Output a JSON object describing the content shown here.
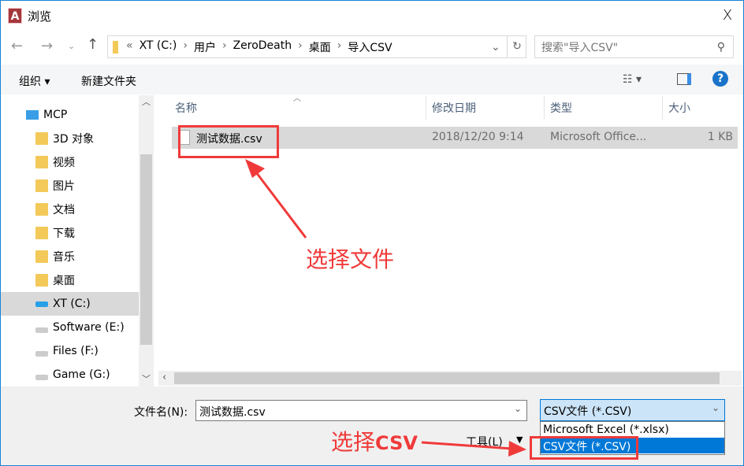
{
  "window": {
    "title": "浏览",
    "close_label": "X"
  },
  "address": {
    "crumbs": [
      "«",
      "XT (C:)",
      "›",
      "用户",
      "›",
      "ZeroDeath",
      "›",
      "桌面",
      "›",
      "导入CSV"
    ],
    "search_placeholder": "搜索\"导入CSV\""
  },
  "toolbar": {
    "organize": "组织 ▾",
    "new_folder": "新建文件夹",
    "help": "?"
  },
  "nav": {
    "items": [
      {
        "label": "MCP",
        "icon": "computer-icon"
      },
      {
        "label": "3D 对象",
        "icon": "3d-folder-icon"
      },
      {
        "label": "视频",
        "icon": "video-folder-icon"
      },
      {
        "label": "图片",
        "icon": "picture-folder-icon"
      },
      {
        "label": "文档",
        "icon": "document-folder-icon"
      },
      {
        "label": "下载",
        "icon": "download-folder-icon"
      },
      {
        "label": "音乐",
        "icon": "music-folder-icon"
      },
      {
        "label": "桌面",
        "icon": "desktop-folder-icon"
      },
      {
        "label": "XT (C:)",
        "icon": "windows-drive-icon",
        "selected": true
      },
      {
        "label": "Software (E:)",
        "icon": "drive-icon"
      },
      {
        "label": "Files (F:)",
        "icon": "drive-icon"
      },
      {
        "label": "Game (G:)",
        "icon": "drive-icon"
      }
    ]
  },
  "columns": [
    "名称",
    "修改日期",
    "类型",
    "大小"
  ],
  "files": [
    {
      "name": "测试数据.csv",
      "modified": "2018/12/20 9:14",
      "type": "Microsoft Office...",
      "size": "1 KB"
    }
  ],
  "bottom": {
    "filename_label": "文件名(N):",
    "filename_value": "测试数据.csv",
    "filetype_selected": "CSV文件 (*.CSV)",
    "filetype_options": [
      "Microsoft Excel (*.xlsx)",
      "CSV文件 (*.CSV)"
    ],
    "tools_label": "工具(L)"
  },
  "annotations": {
    "select_file": "选择文件",
    "select_csv_prefix": "选择",
    "select_csv_suffix": "CSV"
  },
  "colors": {
    "accent": "#0078d7",
    "annotation": "#f03a3a",
    "selection": "#d9d9d9"
  }
}
